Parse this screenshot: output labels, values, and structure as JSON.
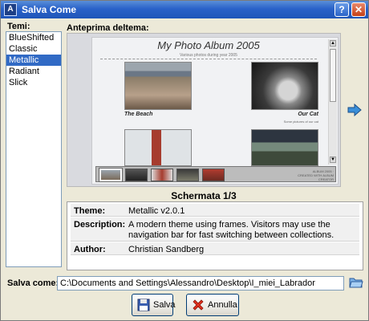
{
  "window": {
    "title": "Salva Come"
  },
  "themes": {
    "label": "Temi:",
    "items": [
      "BlueShifted",
      "Classic",
      "Metallic",
      "Radiant",
      "Slick"
    ],
    "selected_index": 2
  },
  "preview": {
    "label": "Anteprima deltema:",
    "album_title": "My Photo Album 2005",
    "album_subtitle": "Various photos during year 2005",
    "caption_1": "The Beach",
    "caption_2": "Our Cat",
    "caption_2_sub": "Some pictures of our cat",
    "nav_text": "ALBUM 2005 · CREATED WITH ALBUM CREATOR",
    "schermata": "Schermata 1/3"
  },
  "info": {
    "rows": [
      {
        "key": "Theme:",
        "value": "Metallic v2.0.1"
      },
      {
        "key": "Description:",
        "value": "A modern theme using frames. Visitors may use the navigation bar for fast switching between collections."
      },
      {
        "key": "Author:",
        "value": "Christian Sandberg"
      }
    ]
  },
  "save_as": {
    "label": "Salva come:",
    "path": "C:\\Documents and Settings\\Alessandro\\Desktop\\I_miei_Labrador"
  },
  "buttons": {
    "save": "Salva",
    "cancel": "Annulla"
  },
  "colors": {
    "titlebar": "#2a62c9",
    "selection": "#316ac5",
    "arrow": "#3a8fd9"
  },
  "icons": {
    "title": "app-icon",
    "help": "help-icon",
    "close": "close-icon",
    "next": "arrow-right-icon",
    "browse": "folder-open-icon",
    "save": "floppy-disk-icon",
    "cancel": "red-x-icon"
  }
}
